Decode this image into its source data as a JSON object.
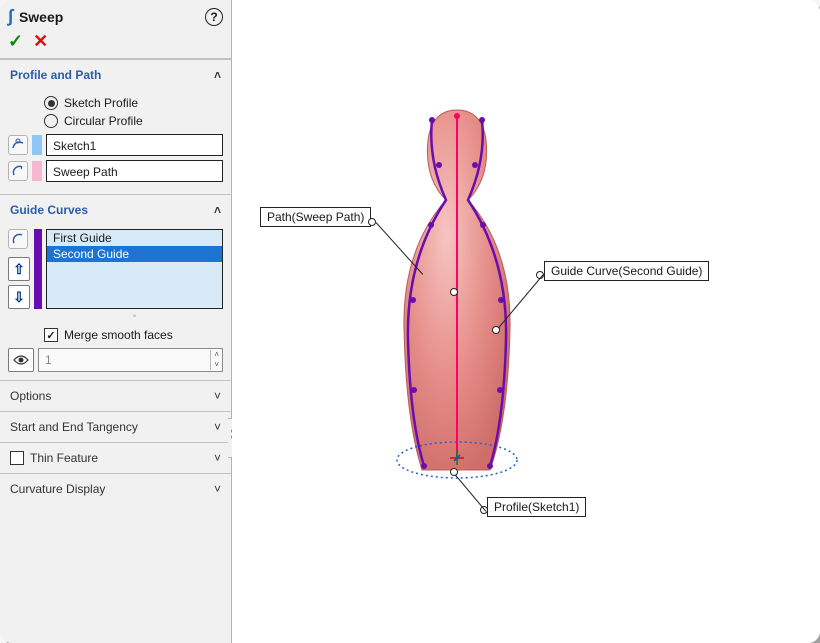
{
  "feature": {
    "title": "Sweep"
  },
  "profile_path": {
    "header": "Profile and Path",
    "sketch_profile_label": "Sketch Profile",
    "circular_profile_label": "Circular Profile",
    "profile_selection": "Sketch1",
    "path_selection": "Sweep Path"
  },
  "guide_curves": {
    "header": "Guide Curves",
    "items": [
      "First Guide",
      "Second Guide"
    ],
    "selected_index": 1,
    "merge_label": "Merge smooth faces",
    "merge_checked": true,
    "visibility_value": "1"
  },
  "sections": {
    "options": "Options",
    "tangency": "Start and End Tangency",
    "thin": "Thin Feature",
    "curvature": "Curvature Display"
  },
  "callouts": {
    "path": "Path(Sweep Path)",
    "guide": "Guide Curve(Second Guide)",
    "profile": "Profile(Sketch1)"
  },
  "colors": {
    "profile_swatch": "#8ec5f7",
    "path_swatch": "#f8b6d0",
    "guide_swatch": "#6a0dad"
  }
}
